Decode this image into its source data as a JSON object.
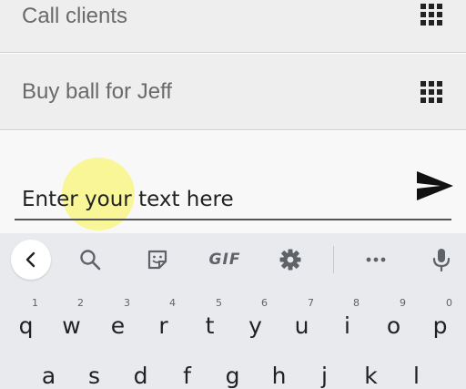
{
  "list": {
    "items": [
      {
        "label": "Call clients"
      },
      {
        "label": "Buy ball for Jeff"
      }
    ]
  },
  "input": {
    "placeholder": "Enter your text here"
  },
  "toolbar": {
    "gif_label": "GIF",
    "icons": [
      "back-icon",
      "search-icon",
      "sticker-icon",
      "gif-icon",
      "settings-icon",
      "more-icon",
      "microphone-icon"
    ]
  },
  "keyboard": {
    "row1": [
      {
        "key": "q",
        "hint": "1"
      },
      {
        "key": "w",
        "hint": "2"
      },
      {
        "key": "e",
        "hint": "3"
      },
      {
        "key": "r",
        "hint": "4"
      },
      {
        "key": "t",
        "hint": "5"
      },
      {
        "key": "y",
        "hint": "6"
      },
      {
        "key": "u",
        "hint": "7"
      },
      {
        "key": "i",
        "hint": "8"
      },
      {
        "key": "o",
        "hint": "9"
      },
      {
        "key": "p",
        "hint": "0"
      }
    ],
    "row2": [
      {
        "key": "a"
      },
      {
        "key": "s"
      },
      {
        "key": "d"
      },
      {
        "key": "f"
      },
      {
        "key": "g"
      },
      {
        "key": "h"
      },
      {
        "key": "j"
      },
      {
        "key": "k"
      },
      {
        "key": "l"
      }
    ]
  },
  "colors": {
    "list_background": "#eeeeee",
    "keyboard_background": "#e8eaed",
    "touch_highlight": "#faf578"
  }
}
